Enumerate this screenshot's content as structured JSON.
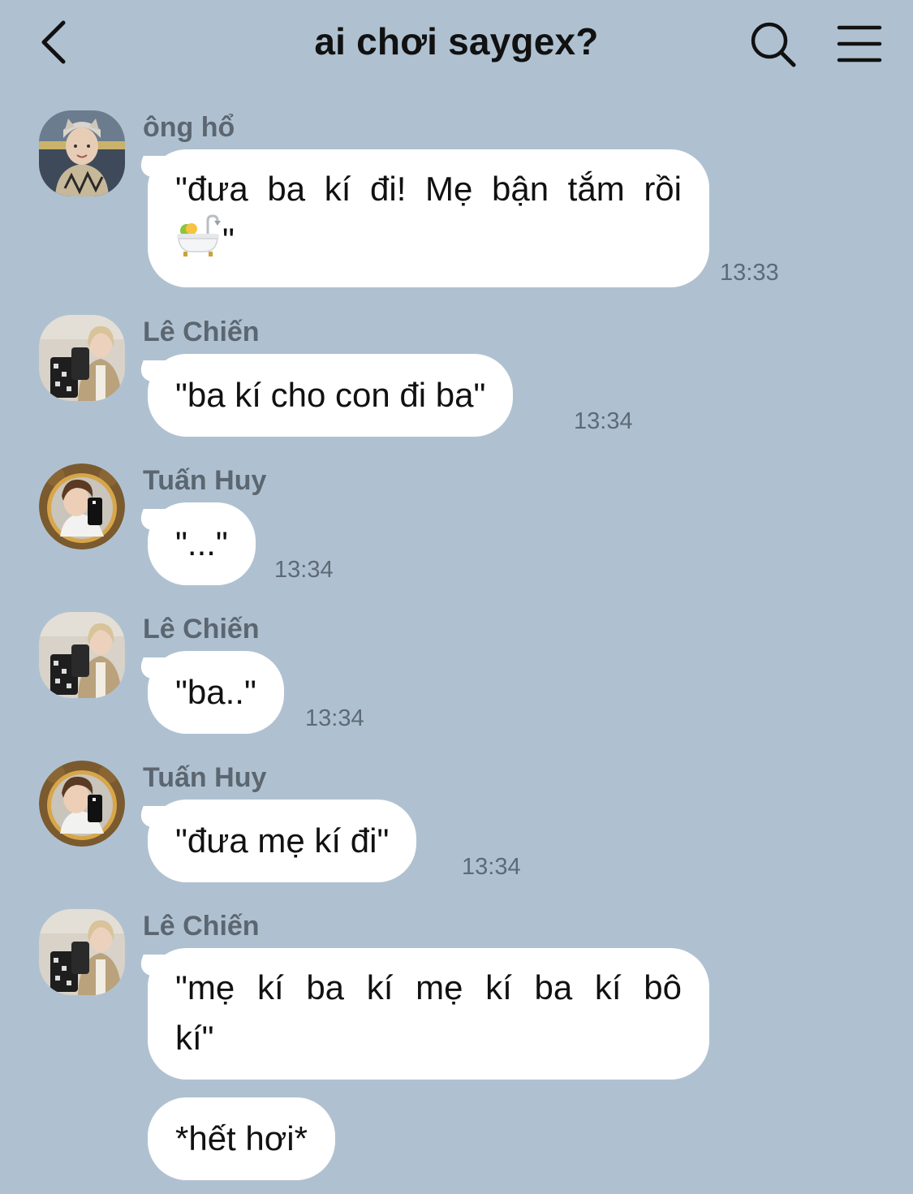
{
  "header": {
    "title": "ai chơi saygex?",
    "back_icon": "chevron-left-icon",
    "search_icon": "search-icon",
    "menu_icon": "hamburger-menu-icon"
  },
  "messages": [
    {
      "sender": "ông hổ",
      "avatar": "avatar-ong-ho",
      "lines": [
        "\"đưa ba kí đi! Mẹ bận tắm rồi",
        "\""
      ],
      "emoji": "bathtub-emoji",
      "time": "13:33"
    },
    {
      "sender": "Lê Chiến",
      "avatar": "avatar-le-chien",
      "text": "\"ba kí cho con đi ba\"",
      "time": "13:34"
    },
    {
      "sender": "Tuấn Huy",
      "avatar": "avatar-tuan-huy",
      "text": "\"...\"",
      "time": "13:34"
    },
    {
      "sender": "Lê Chiến",
      "avatar": "avatar-le-chien",
      "text": "\"ba..\"",
      "time": "13:34"
    },
    {
      "sender": "Tuấn Huy",
      "avatar": "avatar-tuan-huy",
      "text": "\"đưa mẹ kí đi\"",
      "time": "13:34"
    },
    {
      "sender": "Lê Chiến",
      "avatar": "avatar-le-chien",
      "lines": [
        "\"mẹ kí ba kí mẹ kí ba kí bô",
        "kí\""
      ],
      "followup": "*hết hơi*"
    }
  ],
  "colors": {
    "background": "#afc1d1",
    "bubble": "#ffffff",
    "sender_name": "#5b6670",
    "timestamp": "#5e6a76"
  }
}
